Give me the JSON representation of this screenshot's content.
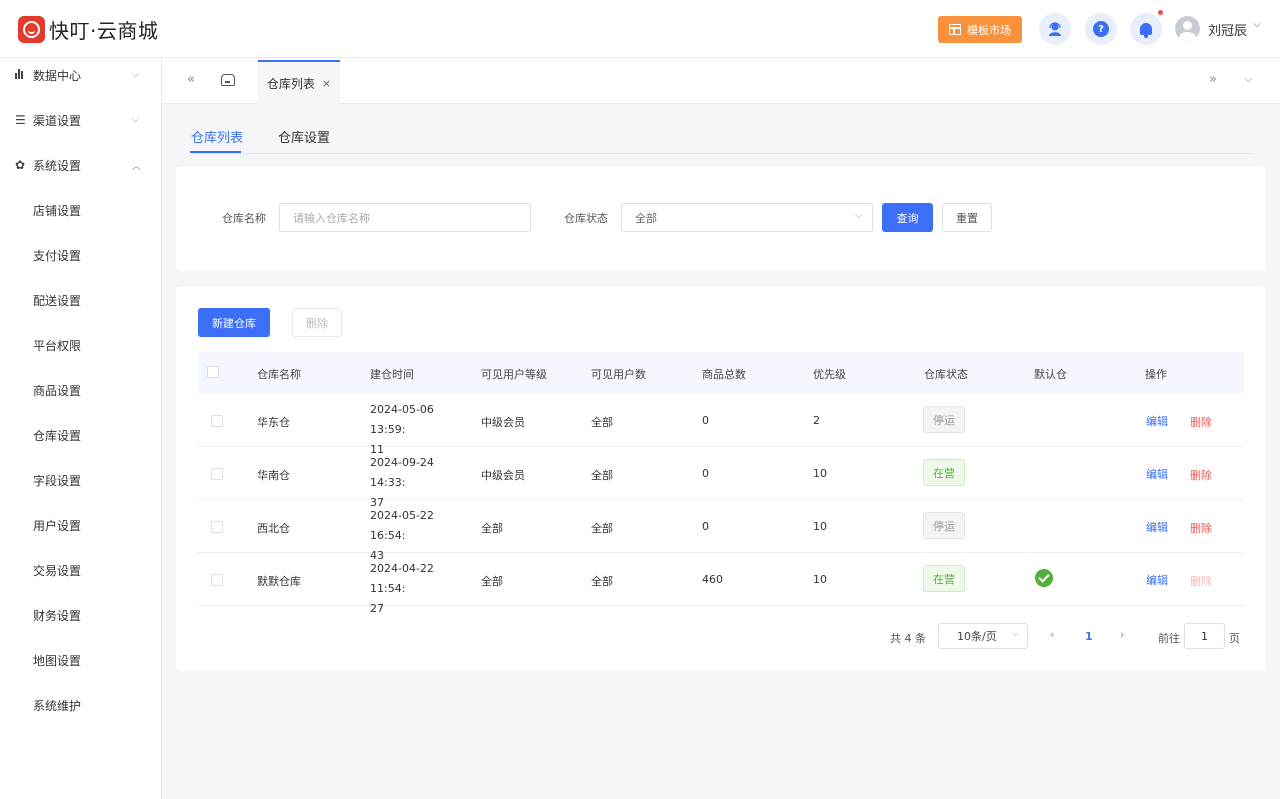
{
  "app": {
    "title": "快叮·云商城"
  },
  "header": {
    "template_market": "模板市场",
    "user_name": "刘冠辰",
    "help_glyph": "?",
    "caret": "⌵"
  },
  "sidebar": {
    "groups": [
      {
        "label": "数据中心",
        "icon": "bar-chart-icon",
        "caret": "⌵"
      },
      {
        "label": "渠道设置",
        "icon": "list-icon",
        "caret": "⌵"
      },
      {
        "label": "系统设置",
        "icon": "gear-icon",
        "caret": "︿"
      }
    ],
    "items": [
      "店铺设置",
      "支付设置",
      "配送设置",
      "平台权限",
      "商品设置",
      "仓库设置",
      "字段设置",
      "用户设置",
      "交易设置",
      "财务设置",
      "地图设置",
      "系统维护"
    ]
  },
  "tabbar": {
    "active_tab": "仓库列表",
    "close": "×",
    "left_glyph": "«",
    "right_glyph": "»",
    "menu_glyph": "⌵"
  },
  "subtabs": [
    "仓库列表",
    "仓库设置"
  ],
  "filter": {
    "name_label": "仓库名称",
    "name_placeholder": "请输入仓库名称",
    "status_label": "仓库状态",
    "status_value": "全部",
    "search_btn": "查询",
    "reset_btn": "重置"
  },
  "actions": {
    "create_btn": "新建仓库",
    "delete_btn": "删除"
  },
  "table": {
    "columns": [
      "仓库名称",
      "建仓时间",
      "可见用户等级",
      "可见用户数",
      "商品总数",
      "优先级",
      "仓库状态",
      "默认仓",
      "操作"
    ],
    "rows": [
      {
        "name": "华东仓",
        "time_line1": "2024-05-06 13:59:",
        "time_line2": "11",
        "level": "中级会员",
        "users": "全部",
        "goods": "0",
        "priority": "2",
        "status": "停运",
        "default": false,
        "edit": "编辑",
        "del": "删除"
      },
      {
        "name": "华南仓",
        "time_line1": "2024-09-24 14:33:",
        "time_line2": "37",
        "level": "中级会员",
        "users": "全部",
        "goods": "0",
        "priority": "10",
        "status": "在营",
        "default": false,
        "edit": "编辑",
        "del": "删除"
      },
      {
        "name": "西北仓",
        "time_line1": "2024-05-22 16:54:",
        "time_line2": "43",
        "level": "全部",
        "users": "全部",
        "goods": "0",
        "priority": "10",
        "status": "停运",
        "default": false,
        "edit": "编辑",
        "del": "删除"
      },
      {
        "name": "默默仓库",
        "time_line1": "2024-04-22 11:54:",
        "time_line2": "27",
        "level": "全部",
        "users": "全部",
        "goods": "460",
        "priority": "10",
        "status": "在营",
        "default": true,
        "edit": "编辑",
        "del": "删除"
      }
    ]
  },
  "pagination": {
    "total": "共 4 条",
    "page_size": "10条/页",
    "current": "1",
    "goto_label": "前往",
    "goto_value": "1",
    "page_unit": "页",
    "prev": "‹",
    "next": "›",
    "caret": "⌵"
  },
  "colors": {
    "primary": "#3b6ff5",
    "warning": "#f8913b",
    "danger": "#f05b5b",
    "success": "#52b13b"
  }
}
